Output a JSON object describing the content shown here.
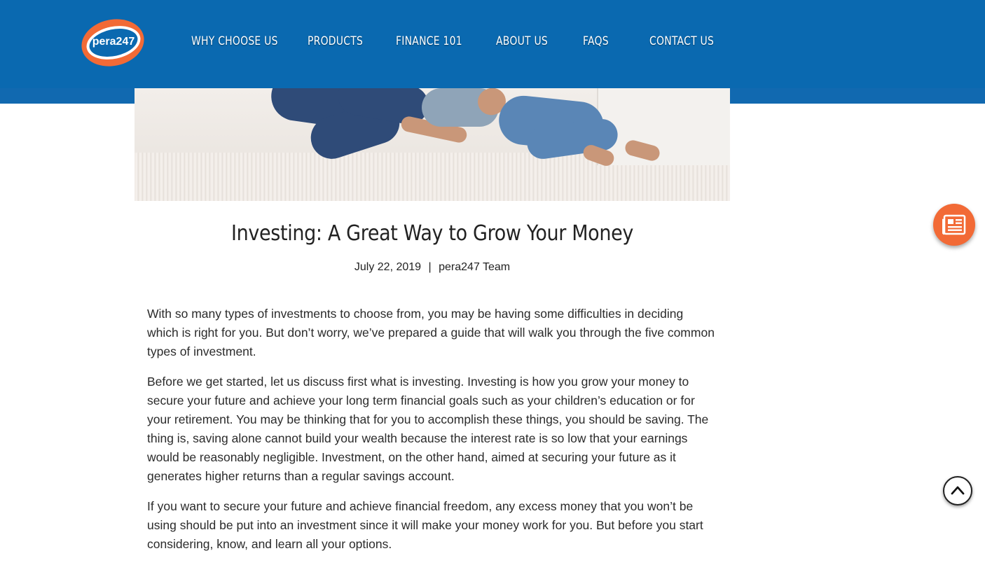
{
  "brand": {
    "logo_text": "pera247"
  },
  "nav": {
    "items": [
      {
        "label": "WHY CHOOSE US"
      },
      {
        "label": "PRODUCTS"
      },
      {
        "label": "FINANCE 101"
      },
      {
        "label": "ABOUT US"
      },
      {
        "label": "FAQS"
      },
      {
        "label": "CONTACT US"
      }
    ]
  },
  "colors": {
    "header_blue": "#0a69b0",
    "accent_orange": "#f26a36"
  },
  "article": {
    "title": "Investing: A Great Way to Grow Your Money",
    "date": "July 22, 2019",
    "separator": "|",
    "author": "pera247 Team",
    "paragraphs": [
      "With so many types of investments to choose from, you may be having some difficulties in deciding which is right for you. But don’t worry, we’ve prepared a guide that will walk you through the five common types of investment.",
      "Before we get started, let us discuss first what is investing. Investing is how you grow your money to secure your future and achieve your long term financial goals such as your children’s education or for your retirement. You may be thinking that for you to accomplish these things, you should be saving. The thing is, saving alone cannot build your wealth because the interest rate is so low that your earnings would be reasonably negligible. Investment, on the other hand, aimed at securing your future as it generates higher returns than a regular savings account.",
      "If you want to secure your future and achieve financial freedom, any excess money that you won’t be using should be put into an investment since it will make your money work for you.  But before you start considering, know, and learn all your options."
    ]
  },
  "floating": {
    "news_icon": "newspaper-icon",
    "top_icon": "chevron-up-icon"
  }
}
